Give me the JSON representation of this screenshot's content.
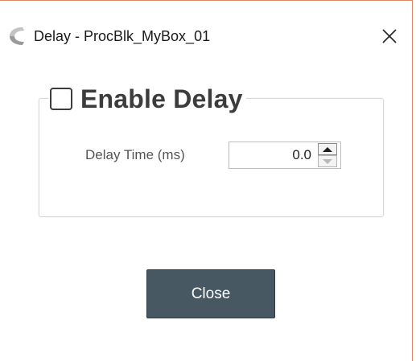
{
  "window": {
    "title": "Delay - ProcBlk_MyBox_01",
    "app_icon": "crescent-logo-icon",
    "close_icon": "close-icon"
  },
  "group": {
    "enable_label": "Enable Delay",
    "enabled": false
  },
  "delay_time": {
    "label": "Delay Time (ms)",
    "value": "0.0",
    "up_icon": "spin-up-icon",
    "down_icon": "spin-down-icon"
  },
  "footer": {
    "close_label": "Close"
  },
  "colors": {
    "button_bg": "#475863",
    "window_border": "#d9896a",
    "text": "#3c3c3c"
  }
}
